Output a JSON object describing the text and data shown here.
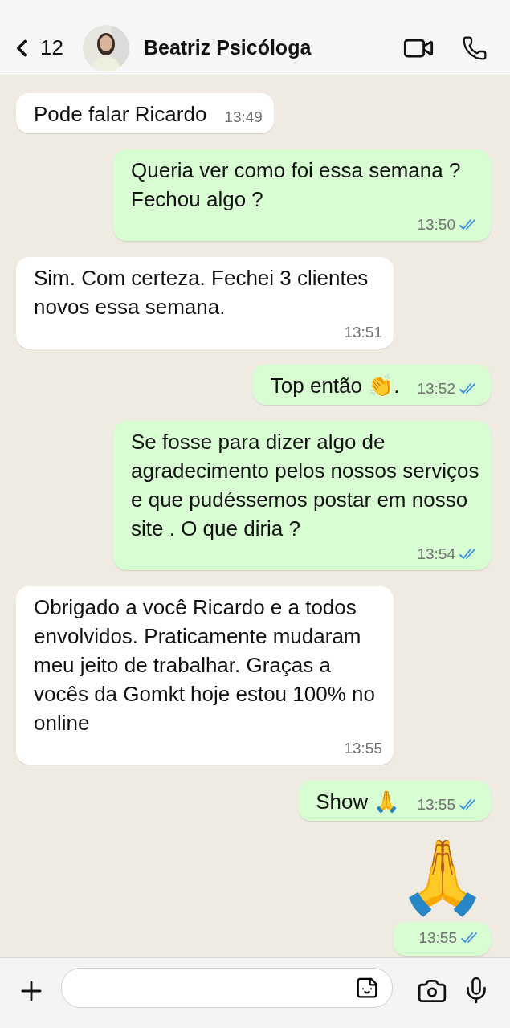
{
  "header": {
    "back_count": "12",
    "contact_name": "Beatriz Psicóloga"
  },
  "messages": [
    {
      "kind": "text",
      "from_me": false,
      "text": "Pode falar Ricardo",
      "time": "13:49"
    },
    {
      "kind": "text",
      "from_me": true,
      "text": "Queria ver como foi essa semana ? Fechou algo ?",
      "time": "13:50",
      "read": true
    },
    {
      "kind": "text",
      "from_me": false,
      "text": "Sim. Com certeza.  Fechei 3 clientes novos essa semana.",
      "time": "13:51"
    },
    {
      "kind": "text",
      "from_me": true,
      "text": "Top então 👏.",
      "time": "13:52",
      "read": true
    },
    {
      "kind": "text",
      "from_me": true,
      "text": "Se fosse para dizer algo de agradecimento pelos nossos serviços e que pudéssemos postar em nosso site . O que diria ?",
      "time": "13:54",
      "read": true
    },
    {
      "kind": "text",
      "from_me": false,
      "text": "Obrigado a você Ricardo e a todos envolvidos. Praticamente mudaram meu jeito de trabalhar. Graças a vocês da Gomkt hoje estou 100% no online",
      "time": "13:55"
    },
    {
      "kind": "text",
      "from_me": true,
      "text": "Show 🙏",
      "time": "13:55",
      "read": true
    },
    {
      "kind": "emoji",
      "from_me": true,
      "text": "🙏",
      "time": "13:55",
      "read": true
    }
  ]
}
